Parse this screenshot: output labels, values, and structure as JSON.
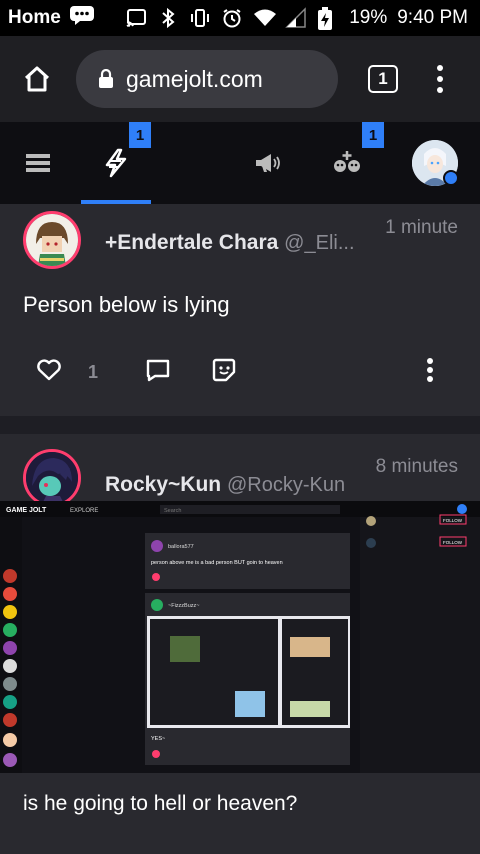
{
  "status_bar": {
    "carrier": "Home",
    "battery": "19%",
    "time": "9:40 PM"
  },
  "browser": {
    "url": "gamejolt.com",
    "tab_count": "1"
  },
  "nav": {
    "activity_badge": "1",
    "friends_badge": "1"
  },
  "posts": [
    {
      "author": "+Endertale Chara",
      "handle": "@_Eli...",
      "time": "1 minute",
      "body": "Person below is lying",
      "likes": "1"
    },
    {
      "author": "Rocky~Kun",
      "handle": "@Rocky-Kun",
      "time": "8 minutes",
      "caption": "is he going to hell or heaven?",
      "embedded": {
        "logo": "GAME JOLT",
        "explore": "EXPLORE",
        "search_placeholder": "Search",
        "inner_author": "ballora577",
        "inner_body": "person above me is a bad person BUT goin to heaven",
        "inner2_author": "~FizzzBuzz~",
        "inner2_reply": "YES~",
        "follow": "FOLLOW"
      }
    }
  ],
  "colors": {
    "accent": "#2f7ff8",
    "avatar_ring": "#ff3d6e",
    "card_bg": "#29292f",
    "feed_bg": "#1e1e24",
    "nav_bg": "#0e0e12"
  }
}
